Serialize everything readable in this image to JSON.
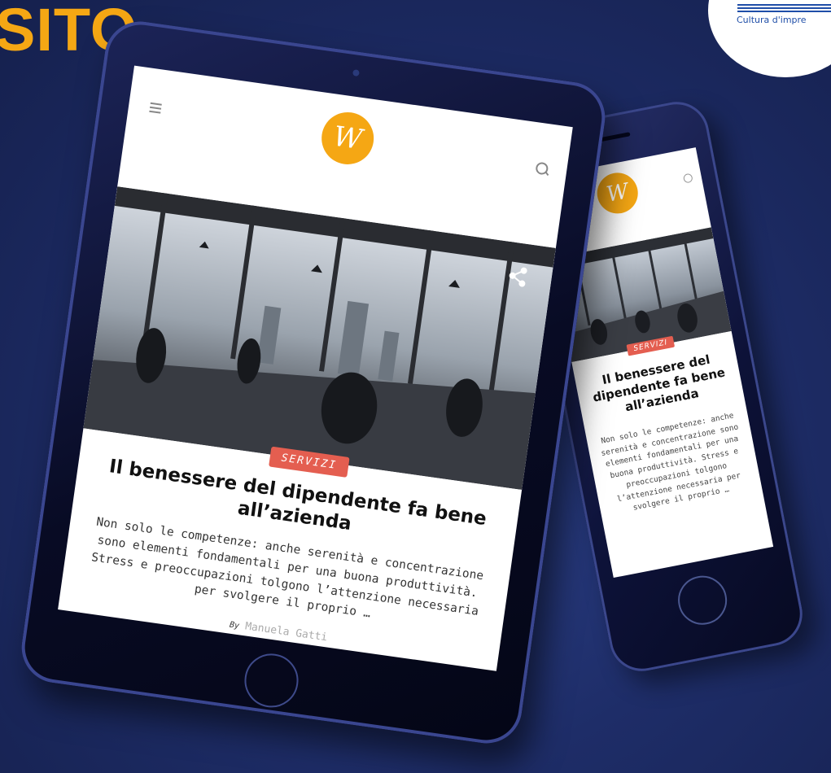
{
  "banner": {
    "headline_fragment": "SITO",
    "badge_text": "Cultura d'impre"
  },
  "brand": {
    "logo_letter": "W",
    "logo_color": "#f5a714"
  },
  "article": {
    "category": "SERVIZI",
    "category_color": "#e45e50",
    "title": "Il benessere del dipendente fa bene all’azienda",
    "excerpt_tablet": "Non solo le competenze: anche serenità e concentrazione sono elementi fondamentali per una buona produttività. Stress e preoccupazioni tolgono l’attenzione necessaria per svolgere il proprio …",
    "excerpt_phone": "Non solo le competenze: anche serenità e concentrazione sono elementi fondamentali per una buona produttività. Stress e preoccupazioni tolgono l’attenzione necessaria per svolgere il proprio …",
    "by_label": "By",
    "author": "Manuela Gatti"
  },
  "icons": {
    "menu": "menu-icon",
    "search": "search-icon",
    "share": "share-icon"
  }
}
